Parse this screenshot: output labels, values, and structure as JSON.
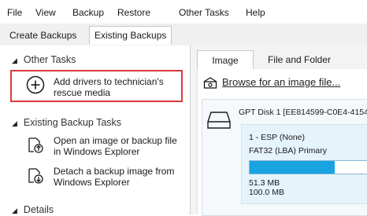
{
  "menu": {
    "items": [
      "File",
      "View",
      "Backup",
      "Restore",
      "Other Tasks",
      "Help"
    ]
  },
  "tabs": {
    "create": "Create Backups",
    "existing": "Existing Backups"
  },
  "sidebar": {
    "other_tasks": {
      "title": "Other Tasks",
      "add_drivers_line1": "Add drivers to technician's",
      "add_drivers_line2": "rescue media"
    },
    "existing_backup_tasks": {
      "title": "Existing Backup Tasks",
      "open_line1": "Open an image or backup file",
      "open_line2": "in Windows Explorer",
      "detach_line1": "Detach a backup image from",
      "detach_line2": "Windows Explorer"
    },
    "details": {
      "title": "Details"
    }
  },
  "main": {
    "tabs": {
      "image": "Image",
      "file_and_folder": "File and Folder"
    },
    "browse_link": "Browse for an image file...",
    "disk": {
      "title": "GPT Disk 1 [EE814599-C0E4-4154",
      "partition": {
        "name": "1 - ESP (None)",
        "fs": "FAT32 (LBA) Primary",
        "used": "51.3 MB",
        "total": "100.0 MB",
        "used_fraction": 0.513
      }
    }
  },
  "colors": {
    "highlight": "#d93a3a",
    "bar_fill": "#17a4e0"
  }
}
